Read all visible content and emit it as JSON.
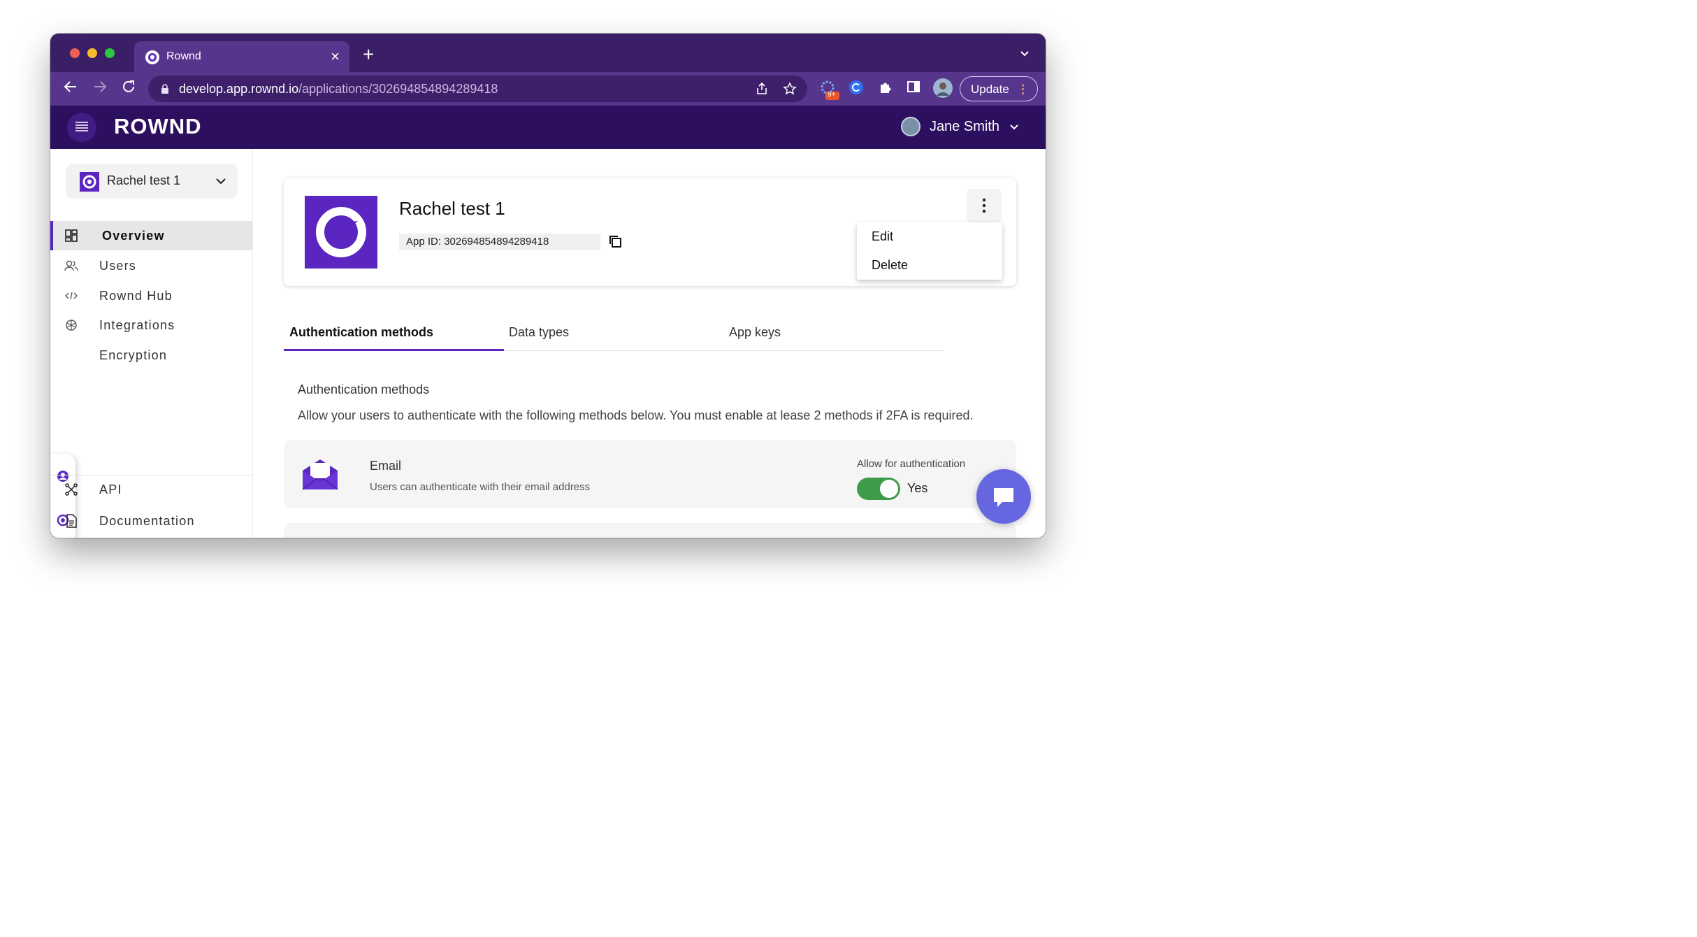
{
  "browser": {
    "tab_title": "Rownd",
    "url_host": "develop.app.rownd.io",
    "url_path": "/applications/302694854894289418",
    "extension_badge": "9+",
    "update_label": "Update"
  },
  "header": {
    "logo": "ROWND",
    "user_name": "Jane Smith"
  },
  "sidebar": {
    "app_selector": "Rachel test 1",
    "items": [
      {
        "label": "Overview",
        "icon": "overview-icon",
        "active": true
      },
      {
        "label": "Users",
        "icon": "users-icon"
      },
      {
        "label": "Rownd Hub",
        "icon": "code-icon"
      },
      {
        "label": "Integrations",
        "icon": "integrations-icon"
      },
      {
        "label": "Encryption",
        "icon": "encryption-icon"
      }
    ],
    "bottom_items": [
      {
        "label": "API",
        "icon": "api-icon"
      },
      {
        "label": "Documentation",
        "icon": "document-icon"
      }
    ]
  },
  "app_card": {
    "name": "Rachel test 1",
    "app_id": "App ID: 302694854894289418",
    "menu": [
      "Edit",
      "Delete"
    ]
  },
  "tabs": [
    "Authentication methods",
    "Data types",
    "App keys"
  ],
  "auth_section": {
    "title": "Authentication methods",
    "description": "Allow your users to authenticate with the following methods below. You must enable at lease 2 methods if 2FA is required.",
    "methods": [
      {
        "name": "Email",
        "description": "Users can authenticate with their email address",
        "allow_label": "Allow for authentication",
        "enabled": true,
        "toggle_label": "Yes"
      }
    ]
  },
  "colors": {
    "brand_purple": "#5b25c2",
    "header_bg": "#2c0f5e",
    "toggle_on": "#3e9b4a"
  }
}
